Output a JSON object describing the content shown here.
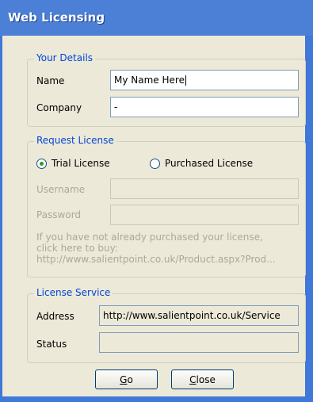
{
  "window": {
    "title": "Web Licensing"
  },
  "your_details": {
    "legend": "Your Details",
    "name_label": "Name",
    "name_value": "My Name Here",
    "company_label": "Company",
    "company_value": "-"
  },
  "request_license": {
    "legend": "Request License",
    "trial_label": "Trial License",
    "purchased_label": "Purchased License",
    "selected": "trial",
    "username_label": "Username",
    "username_value": "",
    "password_label": "Password",
    "password_value": "",
    "info_line1": "If you have not already purchased your license,",
    "info_line2": "click here to buy:",
    "info_line3": "http://www.salientpoint.co.uk/Product.aspx?Prod..."
  },
  "license_service": {
    "legend": "License Service",
    "address_label": "Address",
    "address_value": "http://www.salientpoint.co.uk/Service",
    "status_label": "Status",
    "status_value": ""
  },
  "buttons": {
    "go_mnemonic": "G",
    "go_rest": "o",
    "close_mnemonic": "C",
    "close_rest": "lose"
  },
  "colors": {
    "title_bar": "#4c80d6",
    "legend_text": "#0046d5",
    "radio_dot": "#21a121"
  }
}
